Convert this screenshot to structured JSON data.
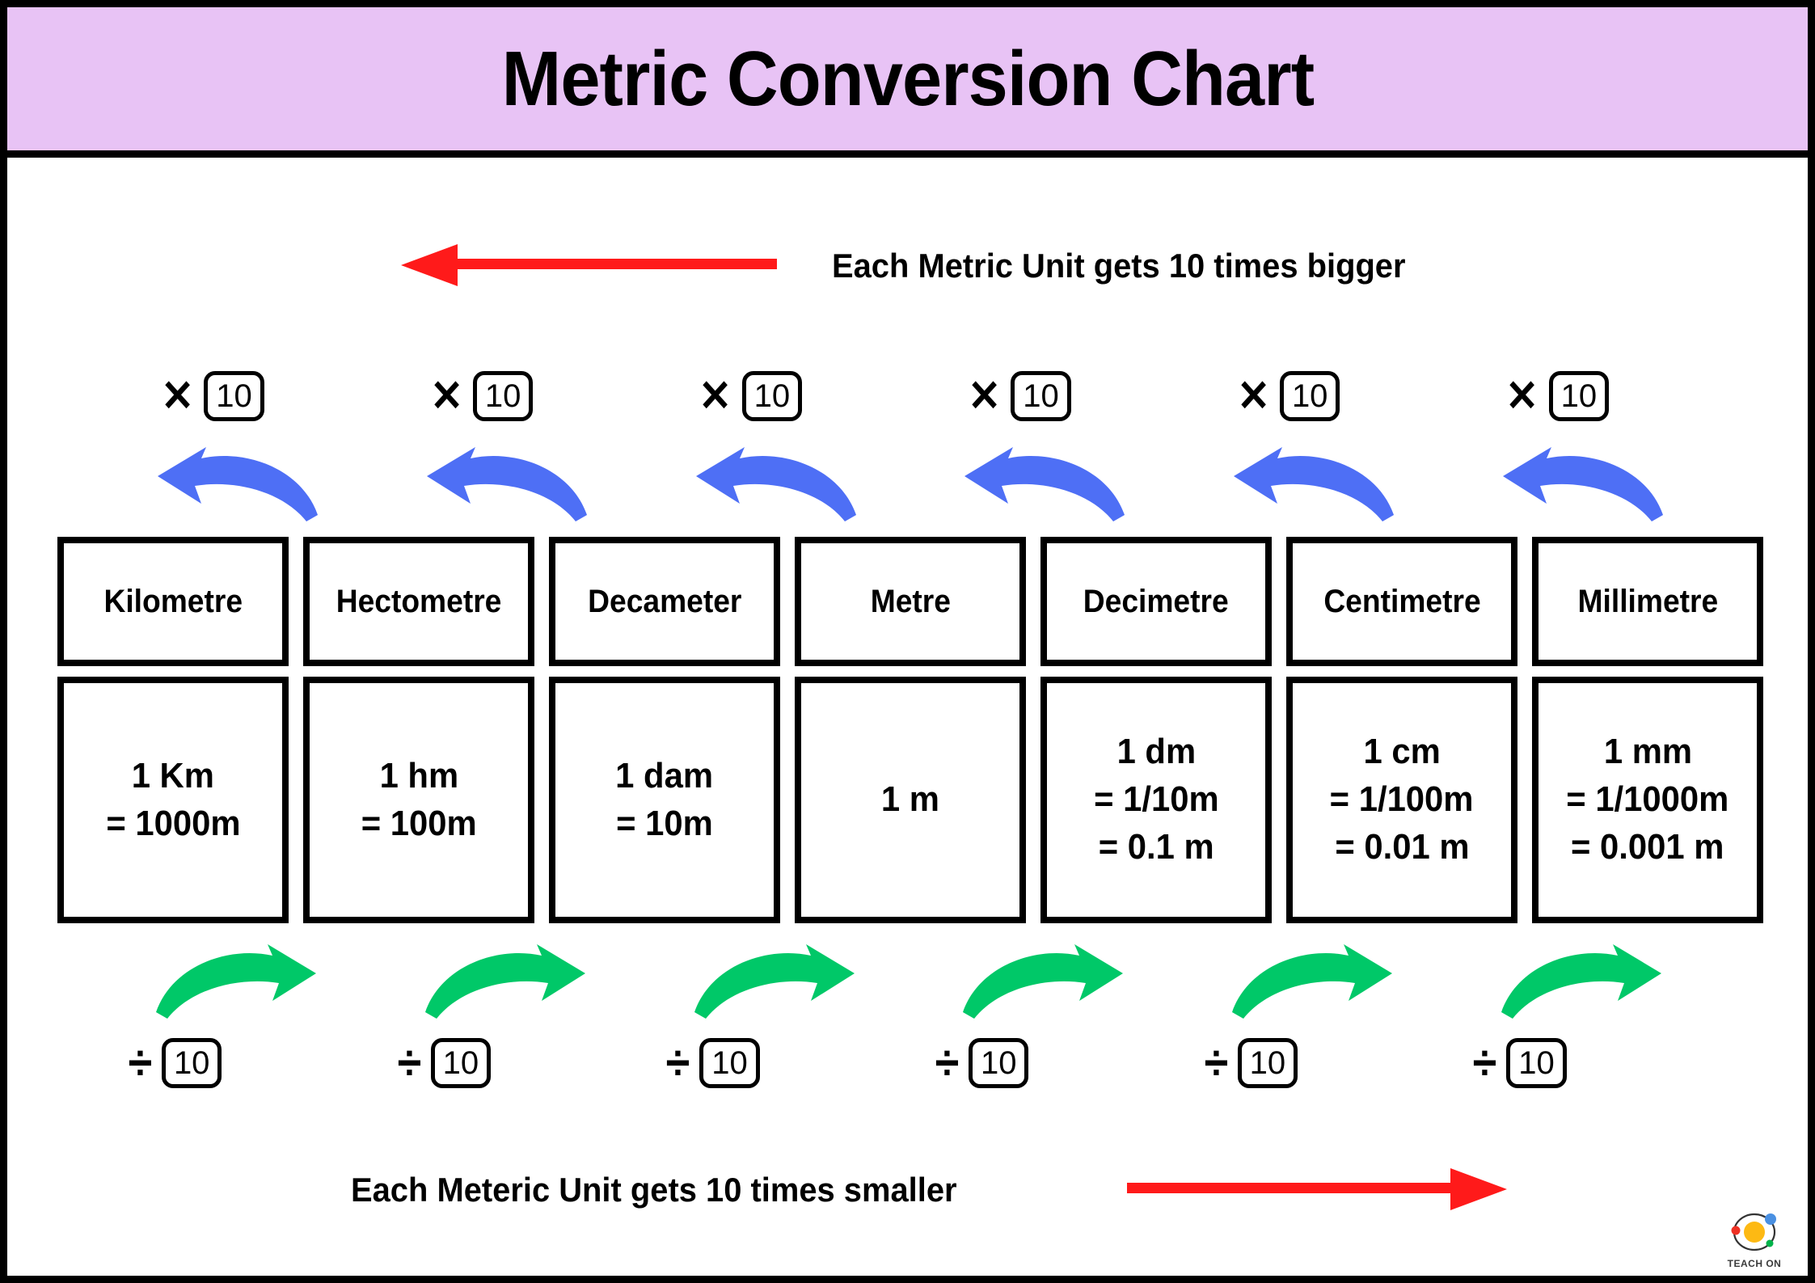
{
  "header": {
    "title": "Metric Conversion Chart",
    "background_color": "#e8c3f5"
  },
  "top_banner": {
    "text": "Each Metric Unit gets 10 times bigger",
    "arrow_direction": "left",
    "arrow_color": "#ff1a1a"
  },
  "bottom_banner": {
    "text": "Each Meteric Unit gets 10 times smaller",
    "arrow_direction": "right",
    "arrow_color": "#ff1a1a"
  },
  "multiply_row": {
    "symbol": "✕",
    "factor": "10",
    "count": 6,
    "items": [
      {
        "symbol": "✕",
        "factor": "10"
      },
      {
        "symbol": "✕",
        "factor": "10"
      },
      {
        "symbol": "✕",
        "factor": "10"
      },
      {
        "symbol": "✕",
        "factor": "10"
      },
      {
        "symbol": "✕",
        "factor": "10"
      },
      {
        "symbol": "✕",
        "factor": "10"
      }
    ]
  },
  "divide_row": {
    "symbol": "÷",
    "factor": "10",
    "count": 6,
    "items": [
      {
        "symbol": "÷",
        "factor": "10"
      },
      {
        "symbol": "÷",
        "factor": "10"
      },
      {
        "symbol": "÷",
        "factor": "10"
      },
      {
        "symbol": "÷",
        "factor": "10"
      },
      {
        "symbol": "÷",
        "factor": "10"
      },
      {
        "symbol": "÷",
        "factor": "10"
      }
    ]
  },
  "blue_arrows": {
    "count": 6,
    "direction": "left",
    "color": "#4e6ff5"
  },
  "green_arrows": {
    "count": 6,
    "direction": "right",
    "color": "#00c868"
  },
  "units": [
    {
      "name": "Kilometre",
      "lines": [
        "1 Km",
        "= 1000m"
      ]
    },
    {
      "name": "Hectometre",
      "lines": [
        "1 hm",
        "= 100m"
      ]
    },
    {
      "name": "Decameter",
      "lines": [
        "1 dam",
        "= 10m"
      ]
    },
    {
      "name": "Metre",
      "lines": [
        "1 m"
      ]
    },
    {
      "name": "Decimetre",
      "lines": [
        "1 dm",
        "= 1/10m",
        "= 0.1 m"
      ]
    },
    {
      "name": "Centimetre",
      "lines": [
        "1 cm",
        "= 1/100m",
        "= 0.01 m"
      ]
    },
    {
      "name": "Millimetre",
      "lines": [
        "1 mm",
        "= 1/1000m",
        "= 0.001 m"
      ]
    }
  ],
  "logo": {
    "text": "TEACH ON",
    "core_color": "#fdb913",
    "dot_blue": "#4a90e2",
    "dot_red": "#ee3124",
    "dot_green": "#00b34a"
  }
}
